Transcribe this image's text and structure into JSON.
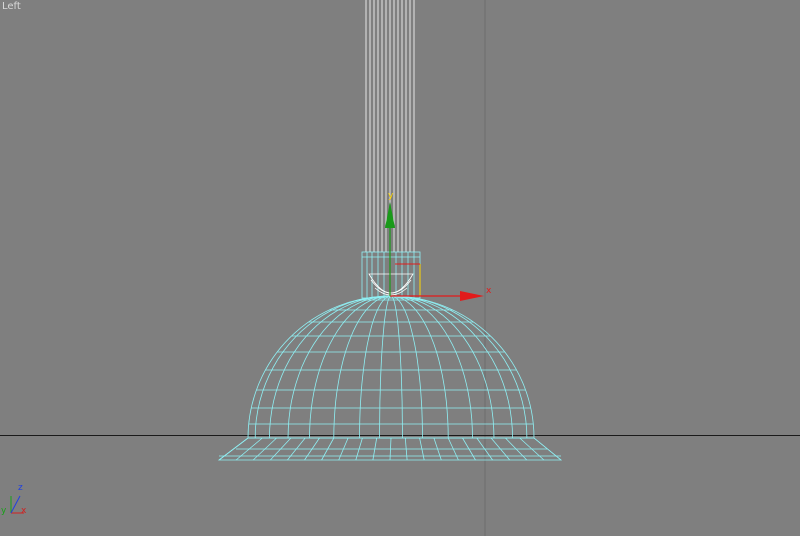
{
  "viewport": {
    "label": "Left",
    "background": "#7f7f7f",
    "wire_color": "#8ff0f4",
    "rod_color": "#ffffff"
  },
  "gizmo": {
    "x_label": "x",
    "y_label": "y",
    "x_color": "#e21b1b",
    "y_color": "#1a9a1a",
    "center_color": "#ffd700"
  },
  "axis_tripod": {
    "z_label": "z",
    "y_label": "y",
    "x_label": "x",
    "z_color": "#2040e0",
    "y_color": "#18a018",
    "x_color": "#d02020"
  }
}
